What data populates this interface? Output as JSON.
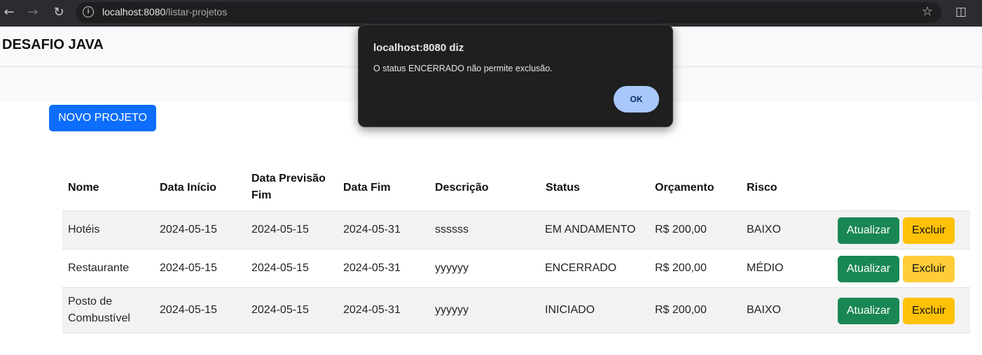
{
  "browser": {
    "url_host": "localhost:8080",
    "url_path": "/listar-projetos"
  },
  "app": {
    "brand": "DESAFIO JAVA",
    "new_project_label": "NOVO PROJETO"
  },
  "table": {
    "headers": {
      "nome": "Nome",
      "data_inicio": "Data Início",
      "data_previsao_l1": "Data Previsão",
      "data_previsao_l2": "Fim",
      "data_fim": "Data Fim",
      "descricao": "Descrição",
      "status": "Status",
      "orcamento": "Orçamento",
      "risco": "Risco"
    },
    "rows": [
      {
        "nome": "Hotéis",
        "nome_l2": "",
        "data_inicio": "2024-05-15",
        "data_previsao": "2024-05-15",
        "data_fim": "2024-05-31",
        "descricao": "ssssss",
        "status": "EM ANDAMENTO",
        "orcamento": "R$ 200,00",
        "risco": "BAIXO",
        "atualizar": "Atualizar",
        "excluir": "Excluir"
      },
      {
        "nome": "Restaurante",
        "nome_l2": "",
        "data_inicio": "2024-05-15",
        "data_previsao": "2024-05-15",
        "data_fim": "2024-05-31",
        "descricao": "yyyyyy",
        "status": "ENCERRADO",
        "orcamento": "R$ 200,00",
        "risco": "MÉDIO",
        "atualizar": "Atualizar",
        "excluir": "Excluir"
      },
      {
        "nome": "Posto de",
        "nome_l2": "Combustível",
        "data_inicio": "2024-05-15",
        "data_previsao": "2024-05-15",
        "data_fim": "2024-05-31",
        "descricao": "yyyyyy",
        "status": "INICIADO",
        "orcamento": "R$ 200,00",
        "risco": "BAIXO",
        "atualizar": "Atualizar",
        "excluir": "Excluir"
      }
    ]
  },
  "dialog": {
    "title": "localhost:8080 diz",
    "message": "O status ENCERRADO não permite exclusão.",
    "ok_label": "OK"
  },
  "colors": {
    "primary": "#0d6efd",
    "success": "#198754",
    "warning": "#ffc107",
    "dialog_bg": "#1f1f1f",
    "dialog_button": "#a8c7fa"
  },
  "icons": {
    "back": "arrow-left-icon",
    "forward": "arrow-right-icon",
    "reload": "reload-icon",
    "site_info": "info-icon",
    "bookmark": "star-icon",
    "extensions": "puzzle-icon"
  }
}
